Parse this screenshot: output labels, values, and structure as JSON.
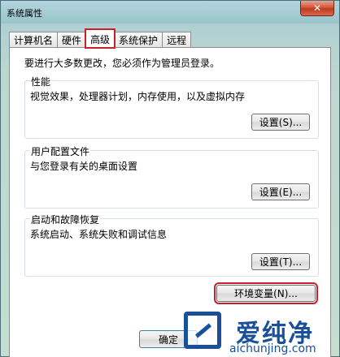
{
  "window": {
    "title": "系统属性",
    "close_glyph": "✕"
  },
  "tabs": [
    {
      "label": "计算机名"
    },
    {
      "label": "硬件"
    },
    {
      "label": "高级"
    },
    {
      "label": "系统保护"
    },
    {
      "label": "远程"
    }
  ],
  "active_tab": "高级",
  "panel": {
    "admin_note": "要进行大多数更改，您必须作为管理员登录。",
    "performance": {
      "title": "性能",
      "desc": "视觉效果，处理器计划，内存使用，以及虚拟内存",
      "button": "设置(S)..."
    },
    "user_profiles": {
      "title": "用户配置文件",
      "desc": "与您登录有关的桌面设置",
      "button": "设置(E)..."
    },
    "startup_recovery": {
      "title": "启动和故障恢复",
      "desc": "系统启动、系统失败和调试信息",
      "button": "设置(T)..."
    },
    "env_button": "环境变量(N)..."
  },
  "footer": {
    "ok_button": "确定"
  },
  "watermark": {
    "text": "爱纯净",
    "url": "aichunjing.com"
  },
  "colors": {
    "highlight": "#c8202a",
    "watermark": "#1a4f9a"
  }
}
